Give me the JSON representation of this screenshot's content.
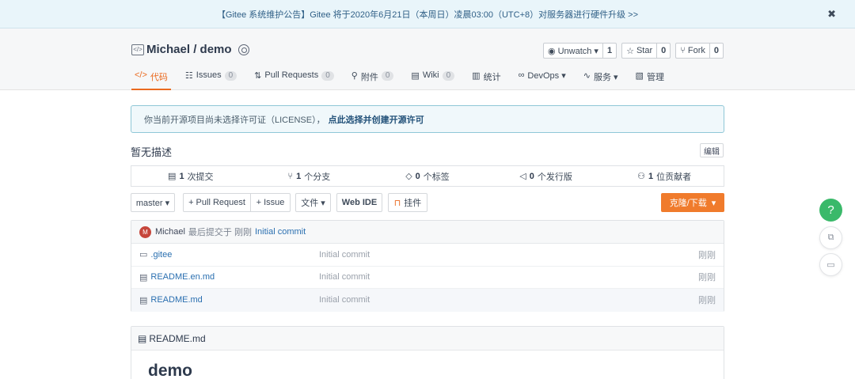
{
  "notice": {
    "text": "【Gitee 系统维护公告】Gitee 将于2020年6月21日（本周日）凌晨03:00（UTC+8）对服务器进行硬件升级 >>",
    "close_icon": "✖"
  },
  "repo": {
    "owner": "Michael",
    "separator": " / ",
    "name": "demo"
  },
  "actions": {
    "watch": {
      "label": "Unwatch ▾",
      "count": "1"
    },
    "star": {
      "label": "Star",
      "count": "0"
    },
    "fork": {
      "label": "Fork",
      "count": "0"
    }
  },
  "tabs": [
    {
      "icon": "</>",
      "label": "代码",
      "badge": ""
    },
    {
      "icon": "☷",
      "label": "Issues",
      "badge": "0"
    },
    {
      "icon": "⇅",
      "label": "Pull Requests",
      "badge": "0"
    },
    {
      "icon": "⚲",
      "label": "附件",
      "badge": "0"
    },
    {
      "icon": "▤",
      "label": "Wiki",
      "badge": "0"
    },
    {
      "icon": "▥",
      "label": "统计",
      "badge": ""
    },
    {
      "icon": "∞",
      "label": "DevOps ▾",
      "badge": ""
    },
    {
      "icon": "∿",
      "label": "服务 ▾",
      "badge": ""
    },
    {
      "icon": "▧",
      "label": "管理",
      "badge": ""
    }
  ],
  "license": {
    "text": "你当前开源项目尚未选择许可证（LICENSE），",
    "link": "点此选择并创建开源许可"
  },
  "description": {
    "text": "暂无描述",
    "edit_label": "编辑"
  },
  "stats": [
    {
      "icon": "▤",
      "count": "1",
      "label": "次提交"
    },
    {
      "icon": "⑂",
      "count": "1",
      "label": "个分支"
    },
    {
      "icon": "◇",
      "count": "0",
      "label": "个标签"
    },
    {
      "icon": "◁",
      "count": "0",
      "label": "个发行版"
    },
    {
      "icon": "⚇",
      "count": "1",
      "label": "位贡献者"
    }
  ],
  "toolbar": {
    "branch": "master ▾",
    "pull_request": "+ Pull Request",
    "issue": "+ Issue",
    "file": "文件 ▾",
    "web_ide": "Web IDE",
    "widget": "挂件",
    "clone": "克隆/下载"
  },
  "last_commit": {
    "avatar": "M",
    "author": "Michael",
    "info": "最后提交于 刚刚",
    "message": "Initial commit"
  },
  "files": [
    {
      "icon": "folder-icon",
      "name": ".gitee",
      "message": "Initial commit",
      "time": "刚刚"
    },
    {
      "icon": "file-icon",
      "name": "README.en.md",
      "message": "Initial commit",
      "time": "刚刚"
    },
    {
      "icon": "file-icon",
      "name": "README.md",
      "message": "Initial commit",
      "time": "刚刚"
    }
  ],
  "readme": {
    "filename": "README.md",
    "heading": "demo"
  },
  "floating": {
    "help": "?"
  },
  "colors": {
    "accent": "#ea6a1f",
    "clone_button": "#f07b2c",
    "help_button": "#3ab96a",
    "link": "#2a6fb0"
  }
}
